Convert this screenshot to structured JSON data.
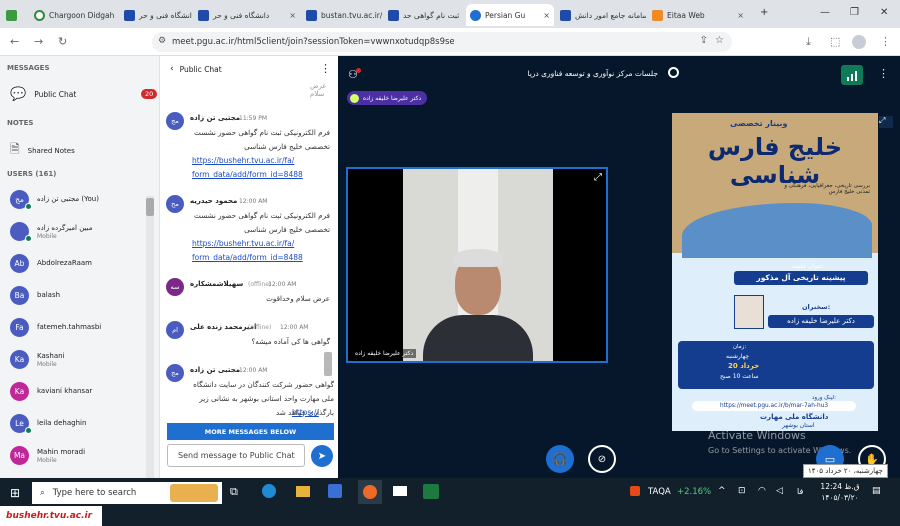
{
  "tabs": [
    {
      "label": "",
      "color": "#3b9b3f"
    },
    {
      "label": "Chargoon Didgah",
      "color": "#2e8b3a"
    },
    {
      "label": "دانشگاه فنی و حر",
      "color": "#1e4aa8"
    },
    {
      "label": "دانشگاه فنی و حر",
      "color": "#1e4aa8"
    },
    {
      "label": "bustan.tvu.ac.ir/",
      "color": "#1e4aa8"
    },
    {
      "label": "ثبت نام گواهی حد",
      "color": "#1e4aa8"
    },
    {
      "label": "Persian Gu",
      "color": "#1f6fd1"
    },
    {
      "label": "سامانه جامع امور دانش",
      "color": "#1e4aa8"
    },
    {
      "label": "Eitaa Web",
      "color": "#f08a24"
    }
  ],
  "address": {
    "url": "meet.pgu.ac.ir/html5client/join?sessionToken=vwwnxotudqp8s9se"
  },
  "sidebar": {
    "messages_header": "MESSAGES",
    "public_chat": "Public Chat",
    "unread": "20",
    "notes_header": "NOTES",
    "shared_notes": "Shared Notes",
    "users_header": "USERS (161)",
    "users": [
      {
        "initials": "مج",
        "name": "مجتبی تن زاده (You)",
        "sub": "",
        "color": "#4a5cc0",
        "mic": true
      },
      {
        "initials": "",
        "name": "مبین امیرگرده زاده",
        "sub": "Mobile",
        "color": "#4a5cc0",
        "mic": true
      },
      {
        "initials": "Ab",
        "name": "AbdolrezaRaam",
        "sub": "",
        "color": "#4a5cc0",
        "mic": false
      },
      {
        "initials": "Ba",
        "name": "balash",
        "sub": "",
        "color": "#4a5cc0",
        "mic": false
      },
      {
        "initials": "Fa",
        "name": "fatemeh.tahmasbi",
        "sub": "",
        "color": "#4a5cc0",
        "mic": false
      },
      {
        "initials": "Ka",
        "name": "Kashani",
        "sub": "Mobile",
        "color": "#4a5cc0",
        "mic": false
      },
      {
        "initials": "Ka",
        "name": "kaviani khansar",
        "sub": "",
        "color": "#c0289a",
        "mic": false
      },
      {
        "initials": "Le",
        "name": "leila dehaghin",
        "sub": "",
        "color": "#4a5cc0",
        "mic": true
      },
      {
        "initials": "Ma",
        "name": "Mahin moradi",
        "sub": "Mobile",
        "color": "#c0289a",
        "mic": false
      }
    ]
  },
  "chat": {
    "title": "Public Chat",
    "messages": [
      {
        "initials": "مج",
        "name": "مجتبی تن زاده",
        "time": "11:59 PM",
        "text": "فرم الکترونیکی ثبت نام گواهی حضور نشست تخصصی خلیج فارس شناسی",
        "link1": "https://bushehr.tvu.ac.ir/fa/",
        "link2": "form_data/add/form_id=8488"
      },
      {
        "initials": "مح",
        "name": "محمود حیدریه",
        "time": "12:00 AM",
        "text": "فرم الکترونیکی ثبت نام گواهی حضور نشست تخصصی خلیج فارس شناسی",
        "link1": "https://bushehr.tvu.ac.ir/fa/",
        "link2": "form_data/add/form_id=8488"
      },
      {
        "initials": "سه",
        "name": "سهیلاشمشکاره",
        "offline": "(offline)",
        "time": "12:00 AM",
        "text": "عرض سلام وخداقوت",
        "link1": "",
        "link2": ""
      },
      {
        "initials": "ام",
        "name": "امیرمحمد زنده علی",
        "offline": "(offline)",
        "time": "12:00 AM",
        "text": "گواهی ها کی آماده میشه؟",
        "link1": "",
        "link2": ""
      },
      {
        "initials": "مج",
        "name": "مجتبی تن زاده",
        "time": "12:00 AM",
        "text": "گواهی حضور شرکت کنندگان در سایت دانشگاه ملی مهارت واحد استانی بوشهر به نشانی زیر بارگذاری خواهد شد",
        "link1": "https://",
        "link2": ""
      }
    ],
    "more": "MORE MESSAGES BELOW",
    "input_placeholder": "Send message to Public Chat"
  },
  "session": {
    "title": "جلسات مرکز نوآوری و توسعه فناوری دریا",
    "presenter_tag": "دکتر علیرضا خلیفه زاده",
    "webcam_label": "دکتر علیرضا خلیفه زاده",
    "watermark1": "Activate Windows",
    "watermark2": "Go to Settings to activate Windows."
  },
  "poster": {
    "subtitle": "وبینار تخصصی",
    "title": "خلیج فارس شناسی",
    "tagline": "بررسی تاریخی، جغرافیایی، فرهنگی و تمدنی خلیج فارس",
    "topic_label": "عنوان جلسه:",
    "topic": "پیشینه تاریخی آل مذکور",
    "speaker_label": "سخنران:",
    "speaker": "دکتر علیرضا خلیفه زاده",
    "time_label": "زمان:",
    "day": "چهارشنبه",
    "date": "20 خرداد",
    "hour": "ساعت 10 صبح",
    "link_label": "لینک ورود:",
    "link": "https://meet.pgu.ac.ir/b/mar-7ah-hu3",
    "university": "دانشگاه ملی مهارت",
    "province": "استان بوشهر"
  },
  "tooltip": "چهارشنبه، ۲۰ خرداد ۱۴۰۵",
  "taskbar": {
    "search_placeholder": "Type here to search",
    "stock_name": "TAQA",
    "stock_change": "+2.16%",
    "lang": "فا",
    "time": "12:24 ق.ظ",
    "date": "۱۴۰۵/۰۳/۲۰",
    "footer_url": "bushehr.tvu.ac.ir"
  }
}
